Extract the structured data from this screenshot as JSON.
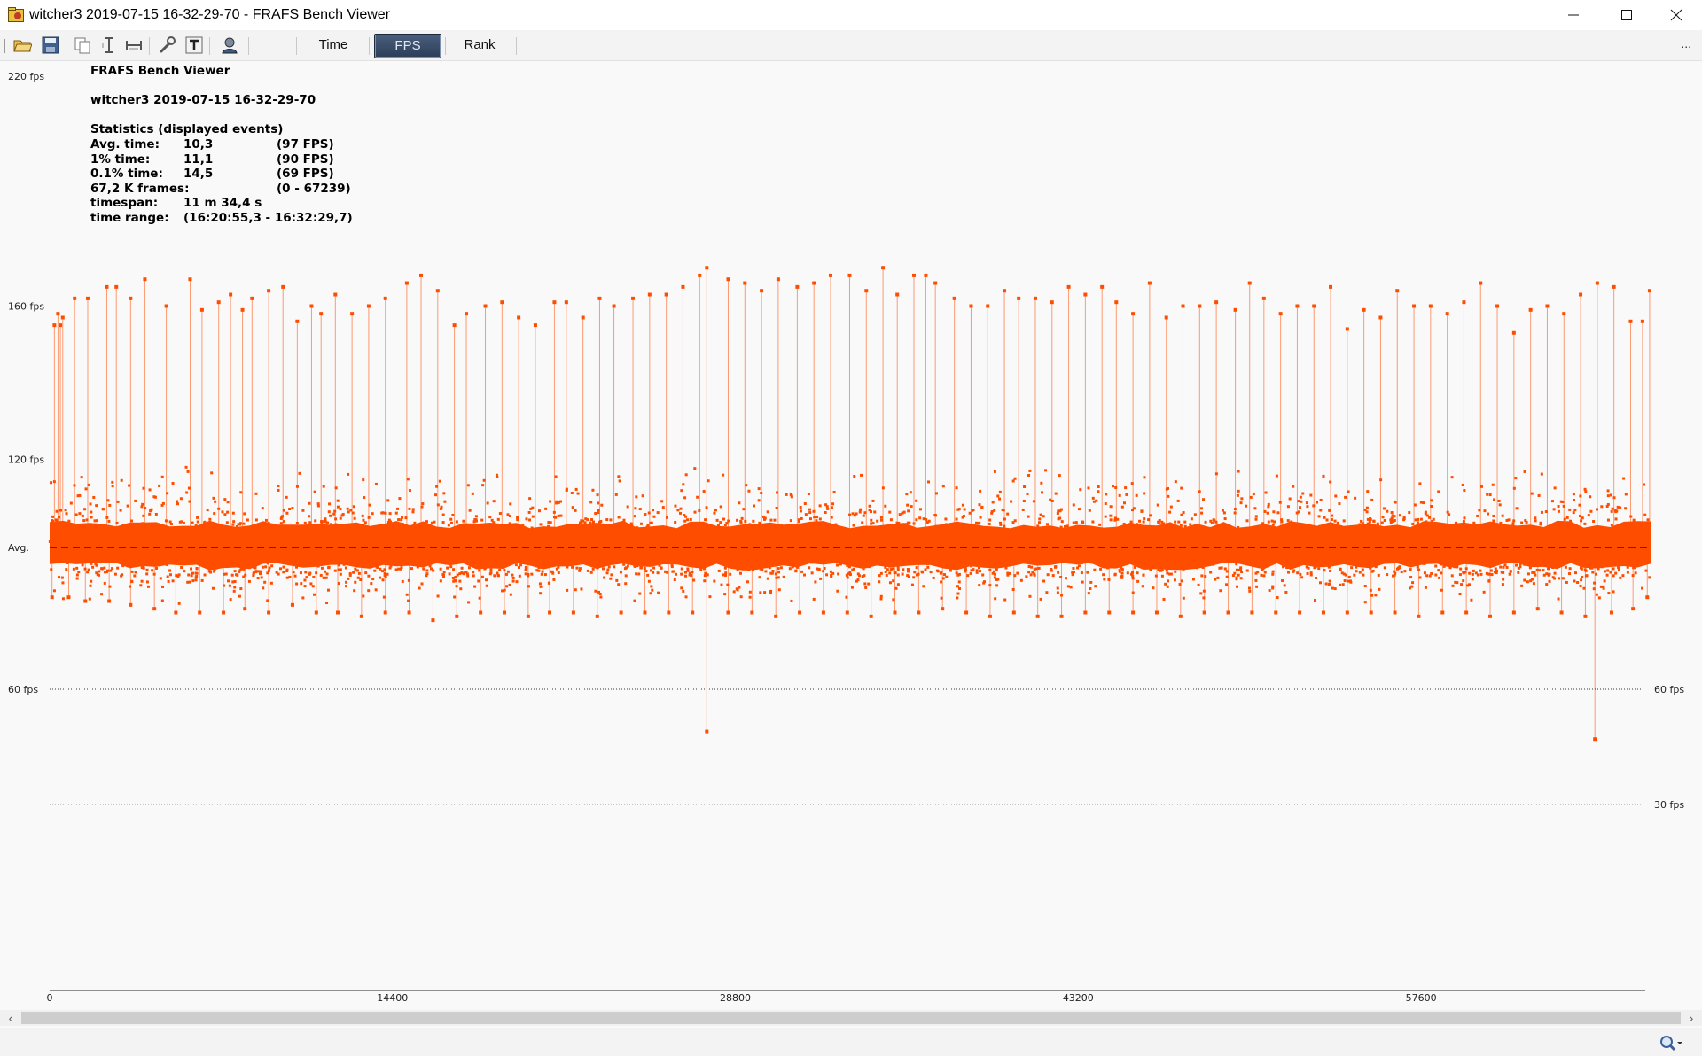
{
  "window": {
    "title": "witcher3 2019-07-15 16-32-29-70 - FRAFS Bench Viewer"
  },
  "toolbar": {
    "icons": [
      "open-folder-icon",
      "save-icon",
      "copy-icon",
      "vertical-range-icon",
      "horizontal-range-icon",
      "wrench-icon",
      "text-icon",
      "user-icon"
    ],
    "mode_buttons": [
      {
        "label": "Time",
        "active": false
      },
      {
        "label": "FPS",
        "active": true
      },
      {
        "label": "Rank",
        "active": false
      }
    ],
    "overflow": "..."
  },
  "stats": {
    "app_name": "FRAFS Bench Viewer",
    "capture_name": "witcher3 2019-07-15 16-32-29-70",
    "header": "Statistics (displayed events)",
    "rows": [
      {
        "label": "Avg. time:",
        "value": "10,3",
        "fps": "(97 FPS)"
      },
      {
        "label": "1% time:",
        "value": "11,1",
        "fps": "(90 FPS)"
      },
      {
        "label": "0.1% time:",
        "value": "14,5",
        "fps": "(69 FPS)"
      },
      {
        "label": "67,2 K frames:",
        "value": "",
        "fps": "(0 - 67239)"
      },
      {
        "label": "timespan:",
        "value": "11 m 34,4 s",
        "fps": ""
      },
      {
        "label": "time range:",
        "value": "(16:20:55,3 - 16:32:29,7)",
        "fps": ""
      }
    ]
  },
  "chart_data": {
    "type": "scatter",
    "title": "",
    "xlabel": "",
    "ylabel": "",
    "x_ticks": [
      "0",
      "14400",
      "28800",
      "43200",
      "57600"
    ],
    "xlim": [
      0,
      67239
    ],
    "ylim": [
      0,
      220
    ],
    "y_tick_labels": [
      "220 fps",
      "160 fps",
      "120 fps",
      "Avg.",
      "60 fps"
    ],
    "y_ticks": [
      220,
      160,
      120,
      97,
      60
    ],
    "avg_line": {
      "label": "Avg.",
      "value": 97,
      "style": "dashed"
    },
    "reference_lines": [
      {
        "label": "60 fps",
        "value": 60
      },
      {
        "label": "30 fps",
        "value": 30
      }
    ],
    "series": [
      {
        "color": "#ff4d00",
        "band": {
          "center": 97,
          "low": 92,
          "high": 103,
          "outer_low": 84,
          "outer_high": 115
        },
        "upper_spikes": [
          [
            200,
            155
          ],
          [
            350,
            158
          ],
          [
            450,
            155
          ],
          [
            550,
            157
          ],
          [
            1050,
            162
          ],
          [
            1600,
            162
          ],
          [
            2400,
            165
          ],
          [
            2800,
            165
          ],
          [
            3400,
            162
          ],
          [
            4000,
            167
          ],
          [
            4900,
            160
          ],
          [
            5900,
            167
          ],
          [
            6400,
            159
          ],
          [
            7100,
            161
          ],
          [
            7600,
            163
          ],
          [
            8100,
            159
          ],
          [
            8500,
            162
          ],
          [
            9200,
            164
          ],
          [
            9800,
            165
          ],
          [
            10400,
            156
          ],
          [
            11000,
            160
          ],
          [
            11400,
            158
          ],
          [
            12000,
            163
          ],
          [
            12700,
            158
          ],
          [
            13400,
            160
          ],
          [
            14100,
            162
          ],
          [
            15000,
            166
          ],
          [
            15600,
            168
          ],
          [
            16300,
            164
          ],
          [
            17000,
            155
          ],
          [
            17500,
            158
          ],
          [
            18300,
            160
          ],
          [
            19000,
            161
          ],
          [
            19700,
            157
          ],
          [
            20400,
            155
          ],
          [
            21200,
            161
          ],
          [
            21700,
            161
          ],
          [
            22400,
            157
          ],
          [
            23100,
            162
          ],
          [
            23700,
            160
          ],
          [
            24500,
            162
          ],
          [
            25200,
            163
          ],
          [
            25900,
            163
          ],
          [
            26600,
            165
          ],
          [
            27300,
            168
          ],
          [
            27600,
            170
          ],
          [
            28500,
            167
          ],
          [
            29200,
            166
          ],
          [
            29900,
            164
          ],
          [
            30600,
            167
          ],
          [
            31400,
            165
          ],
          [
            32100,
            166
          ],
          [
            32800,
            168
          ],
          [
            33600,
            168
          ],
          [
            34300,
            164
          ],
          [
            35000,
            170
          ],
          [
            35600,
            163
          ],
          [
            36300,
            168
          ],
          [
            36800,
            168
          ],
          [
            37200,
            166
          ],
          [
            38000,
            162
          ],
          [
            38700,
            160
          ],
          [
            39400,
            160
          ],
          [
            40100,
            164
          ],
          [
            40700,
            162
          ],
          [
            41400,
            162
          ],
          [
            42100,
            161
          ],
          [
            42800,
            165
          ],
          [
            43500,
            163
          ],
          [
            44200,
            165
          ],
          [
            44800,
            161
          ],
          [
            45500,
            158
          ],
          [
            46200,
            166
          ],
          [
            46900,
            157
          ],
          [
            47600,
            160
          ],
          [
            48300,
            160
          ],
          [
            49000,
            161
          ],
          [
            49800,
            159
          ],
          [
            50400,
            166
          ],
          [
            51000,
            162
          ],
          [
            51700,
            158
          ],
          [
            52400,
            160
          ],
          [
            53100,
            160
          ],
          [
            53800,
            165
          ],
          [
            54500,
            154
          ],
          [
            55200,
            159
          ],
          [
            55900,
            157
          ],
          [
            56600,
            164
          ],
          [
            57300,
            160
          ],
          [
            58000,
            160
          ],
          [
            58700,
            158
          ],
          [
            59400,
            161
          ],
          [
            60100,
            166
          ],
          [
            60800,
            160
          ],
          [
            61500,
            153
          ],
          [
            62200,
            159
          ],
          [
            62900,
            160
          ],
          [
            63600,
            158
          ],
          [
            64300,
            163
          ],
          [
            65000,
            166
          ],
          [
            65700,
            165
          ],
          [
            66400,
            156
          ],
          [
            66900,
            156
          ],
          [
            67200,
            164
          ]
        ],
        "lower_spikes": [
          [
            100,
            84
          ],
          [
            800,
            84
          ],
          [
            1500,
            83
          ],
          [
            2500,
            83
          ],
          [
            3400,
            82
          ],
          [
            4400,
            81
          ],
          [
            5300,
            80
          ],
          [
            6300,
            80
          ],
          [
            7300,
            80
          ],
          [
            8200,
            81
          ],
          [
            9200,
            80
          ],
          [
            10200,
            82
          ],
          [
            11200,
            80
          ],
          [
            12100,
            80
          ],
          [
            13100,
            79
          ],
          [
            14100,
            80
          ],
          [
            15100,
            80
          ],
          [
            16100,
            78
          ],
          [
            17100,
            79
          ],
          [
            18100,
            80
          ],
          [
            19100,
            80
          ],
          [
            20100,
            79
          ],
          [
            21000,
            80
          ],
          [
            22000,
            80
          ],
          [
            23000,
            79
          ],
          [
            24000,
            80
          ],
          [
            25000,
            80
          ],
          [
            26000,
            80
          ],
          [
            27000,
            80
          ],
          [
            27600,
            49
          ],
          [
            28500,
            80
          ],
          [
            29500,
            80
          ],
          [
            30500,
            79
          ],
          [
            31500,
            80
          ],
          [
            32500,
            80
          ],
          [
            33500,
            80
          ],
          [
            34500,
            79
          ],
          [
            35500,
            80
          ],
          [
            36500,
            80
          ],
          [
            37500,
            81
          ],
          [
            38500,
            80
          ],
          [
            39500,
            79
          ],
          [
            40500,
            80
          ],
          [
            41500,
            79
          ],
          [
            42500,
            79
          ],
          [
            43500,
            80
          ],
          [
            44500,
            80
          ],
          [
            45500,
            80
          ],
          [
            46500,
            80
          ],
          [
            47500,
            79
          ],
          [
            48500,
            80
          ],
          [
            49500,
            80
          ],
          [
            50500,
            80
          ],
          [
            51500,
            80
          ],
          [
            52500,
            80
          ],
          [
            53500,
            80
          ],
          [
            54500,
            80
          ],
          [
            55500,
            80
          ],
          [
            56500,
            80
          ],
          [
            57500,
            79
          ],
          [
            58500,
            80
          ],
          [
            59500,
            80
          ],
          [
            60500,
            79
          ],
          [
            61500,
            80
          ],
          [
            62500,
            81
          ],
          [
            63500,
            80
          ],
          [
            64500,
            79
          ],
          [
            64900,
            47
          ],
          [
            65600,
            80
          ],
          [
            66500,
            81
          ],
          [
            67100,
            84
          ]
        ]
      }
    ],
    "grid": false,
    "legend": "none"
  },
  "scrollbar": {
    "left_arrow": "‹",
    "right_arrow": "›"
  },
  "status": {
    "zoom_icon": "zoom-icon"
  }
}
